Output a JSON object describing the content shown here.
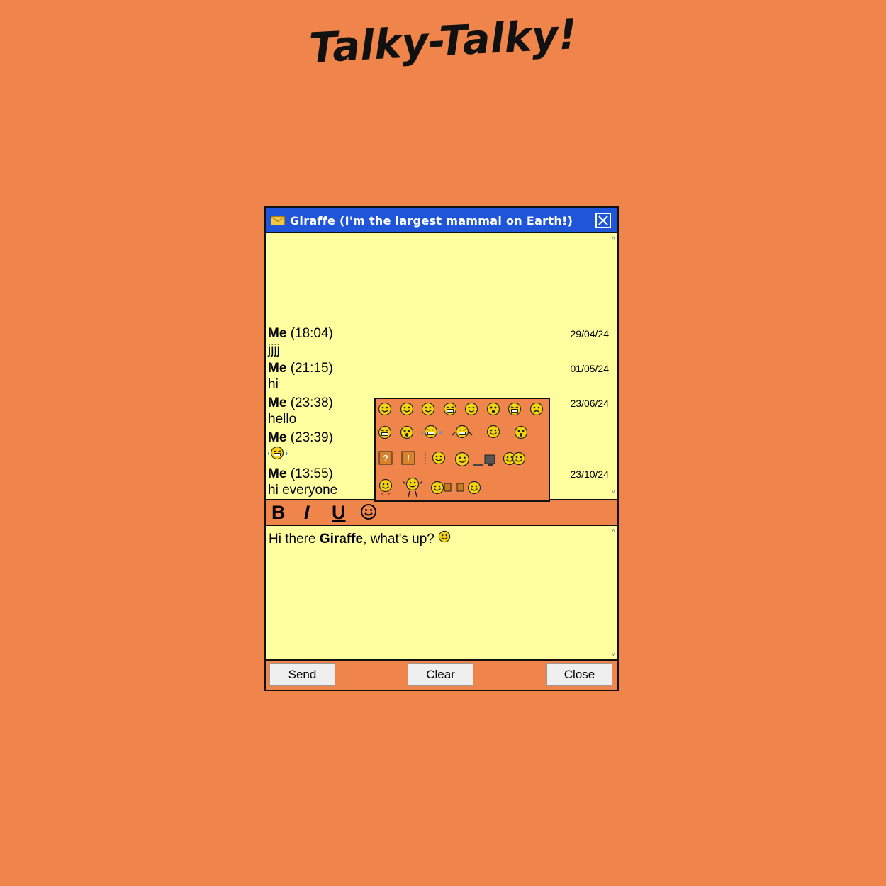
{
  "app": {
    "logo_text": "Talky-Talky!"
  },
  "window": {
    "title": "Giraffe (I'm the largest mammal on Earth!)",
    "icon": "envelope-icon",
    "close_icon": "close-icon"
  },
  "messages": [
    {
      "sender": "Me",
      "time": "(18:04)",
      "text": "jjjj",
      "date": "29/04/24"
    },
    {
      "sender": "Me",
      "time": "(21:15)",
      "text": "hi",
      "date": "01/05/24"
    },
    {
      "sender": "Me",
      "time": "(23:38)",
      "text": "hello",
      "date": "23/06/24"
    },
    {
      "sender": "Me",
      "time": "(23:39)",
      "text": "",
      "emoji": "laughing-crying-emoji",
      "date": ""
    },
    {
      "sender": "Me",
      "time": "(13:55)",
      "text": "hi everyone",
      "date": "23/10/24"
    }
  ],
  "toolbar": {
    "bold_label": "B",
    "italic_label": "I",
    "underline_label": "U",
    "emoji_icon": "smiley-icon"
  },
  "emoji_panel": {
    "rows": [
      [
        "smile",
        "grin",
        "happy",
        "teeth",
        "tongue",
        "dizzy",
        "laugh",
        "sad"
      ],
      [
        "big-grin",
        "confused",
        "laughing-crying",
        "rofl",
        "surprised-happy",
        "shocked"
      ],
      [
        "question-box",
        "exclamation-box",
        "sleepy",
        "computer",
        "hug"
      ],
      [
        "waving",
        "dancing",
        "drinking-buddies"
      ]
    ]
  },
  "compose": {
    "text_before": "Hi there ",
    "text_bold": "Giraffe",
    "text_after": ", what's up? ",
    "inline_emoji": "smile-emoji"
  },
  "buttons": {
    "send": "Send",
    "clear": "Clear",
    "close": "Close"
  },
  "colors": {
    "background": "#f0854b",
    "titlebar": "#1f55d9",
    "panel": "#ffffa0",
    "emoji_yellow": "#f5d311"
  }
}
